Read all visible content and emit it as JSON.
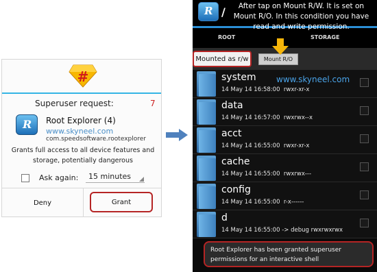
{
  "dialog": {
    "title": "Superuser request:",
    "countdown": "7",
    "app_icon_letter": "R",
    "app_name": "Root Explorer (4)",
    "watermark": "www.skyneel.com",
    "package": "com.speedsoftware.rootexplorer",
    "description": "Grants full access to all device features and storage, potentially dangerous",
    "ask_again_label": "Ask again:",
    "ask_again_checked": false,
    "duration": "15 minutes",
    "deny_label": "Deny",
    "grant_label": "Grant",
    "accent_color": "#33b5e5",
    "highlight_color": "#b52424"
  },
  "arrow": {
    "icon": "right-arrow-icon",
    "color": "#4f81bd"
  },
  "phone": {
    "app_icon_letter": "R",
    "path": "/",
    "note": "After tap on Mount R/W. It  is set on Mount R/O. In this condition you have read and write permission.",
    "tabs": [
      "ROOT",
      "STORAGE"
    ],
    "mount_status": "Mounted as r/w",
    "mount_button": "Mount R/O",
    "watermark": "www.skyneel.com",
    "files": [
      {
        "name": "system",
        "meta": "14 May 14 16:58:00  rwxr-xr-x"
      },
      {
        "name": "data",
        "meta": "14 May 14 16:57:00  rwxrwx--x"
      },
      {
        "name": "acct",
        "meta": "14 May 14 16:55:00  rwxr-xr-x"
      },
      {
        "name": "cache",
        "meta": "14 May 14 16:55:00  rwxrwx---"
      },
      {
        "name": "config",
        "meta": "14 May 14 16:55:00  r-x------"
      },
      {
        "name": "d",
        "meta": "14 May 14 16:55:00 -> debug rwxrwxrwx"
      }
    ],
    "toast": "Root Explorer has been granted superuser permissions for an interactive shell",
    "arrow_color": "#f5b50a"
  }
}
